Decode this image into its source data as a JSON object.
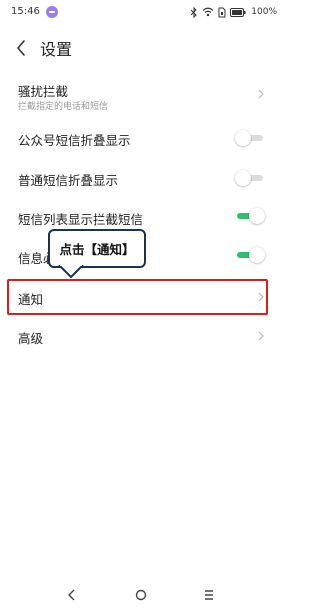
{
  "status_bar": {
    "time": "15:46",
    "battery": "100%",
    "app_dot_color": "#9a7cf0",
    "icons": [
      "bluetooth-icon",
      "wifi-icon",
      "sim-icon",
      "battery-icon"
    ]
  },
  "header": {
    "title": "设置",
    "back_icon": "chevron-left-icon"
  },
  "rows": [
    {
      "label": "骚扰拦截",
      "sublabel": "拦截指定的电话和短信",
      "control": "chevron"
    },
    {
      "label": "公众号短信折叠显示",
      "control": "toggle",
      "on": false
    },
    {
      "label": "普通短信折叠显示",
      "control": "toggle",
      "on": false
    },
    {
      "label": "短信列表显示拦截短信",
      "control": "toggle",
      "on": true
    },
    {
      "label": "信息必达",
      "control": "toggle",
      "on": true
    },
    {
      "label": "通知",
      "control": "chevron"
    },
    {
      "label": "高级",
      "control": "chevron"
    }
  ],
  "tooltip": {
    "text": "点击【通知】",
    "border_color": "#1d3152"
  },
  "highlight_color": "#e11b1b",
  "toggle_on_color": "#2fbf6b",
  "nav_bar": {
    "icons": [
      "back-triangle-icon",
      "home-circle-icon",
      "menu-lines-icon"
    ]
  }
}
